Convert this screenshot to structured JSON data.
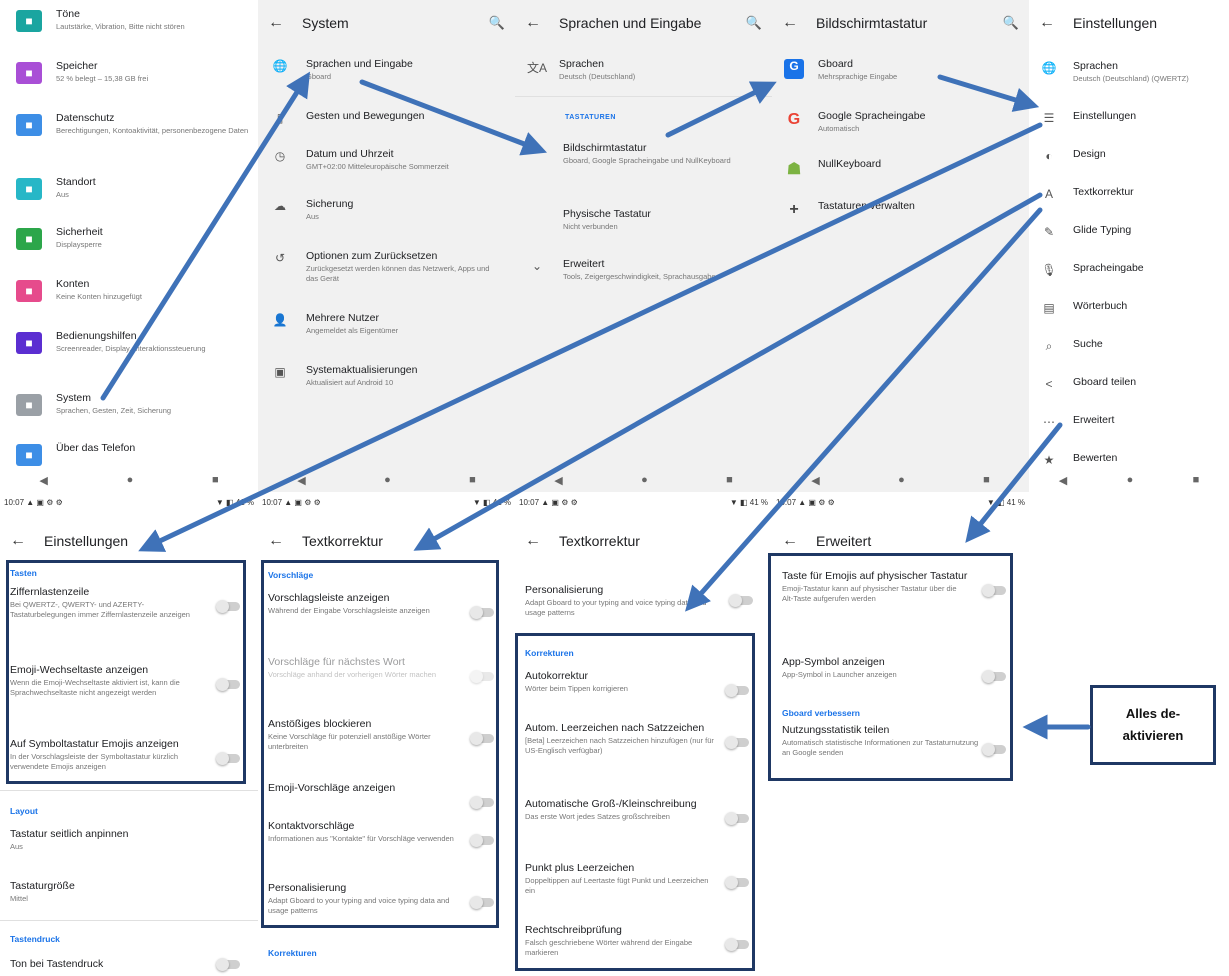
{
  "settings_list": {
    "items": [
      {
        "title": "Töne",
        "sub": "Lautstärke, Vibration, Bitte nicht stören",
        "color": "#1aa5a0",
        "icon": "volume-icon"
      },
      {
        "title": "Speicher",
        "sub": "52 % belegt – 15,38 GB frei",
        "color": "#a94fd6",
        "icon": "storage-icon"
      },
      {
        "title": "Datenschutz",
        "sub": "Berechtigungen, Kontoaktivität, personenbezogene Daten",
        "color": "#3d8ee6",
        "icon": "privacy-icon"
      },
      {
        "title": "Standort",
        "sub": "Aus",
        "color": "#27b7c7",
        "icon": "location-icon"
      },
      {
        "title": "Sicherheit",
        "sub": "Displaysperre",
        "color": "#2ca64a",
        "icon": "lock-icon"
      },
      {
        "title": "Konten",
        "sub": "Keine Konten hinzugefügt",
        "color": "#e64b8c",
        "icon": "account-icon"
      },
      {
        "title": "Bedienungshilfen",
        "sub": "Screenreader, Display, Interaktionssteuerung",
        "color": "#5b2ed1",
        "icon": "accessibility-icon"
      },
      {
        "title": "System",
        "sub": "Sprachen, Gesten, Zeit, Sicherung",
        "color": "#9aa0a6",
        "icon": "info-icon"
      },
      {
        "title": "Über das Telefon",
        "sub": "",
        "color": "#3d8ee6",
        "icon": "phone-icon"
      }
    ]
  },
  "system": {
    "title": "System",
    "items": [
      {
        "title": "Sprachen und Eingabe",
        "sub": "Gboard",
        "icon": "globe-icon",
        "glyph": "🌐"
      },
      {
        "title": "Gesten und Bewegungen",
        "sub": "",
        "icon": "gesture-icon",
        "glyph": "▯"
      },
      {
        "title": "Datum und Uhrzeit",
        "sub": "GMT+02:00 Mitteleuropäische Sommerzeit",
        "icon": "clock-icon",
        "glyph": "◷"
      },
      {
        "title": "Sicherung",
        "sub": "Aus",
        "icon": "backup-icon",
        "glyph": "☁"
      },
      {
        "title": "Optionen zum Zurücksetzen",
        "sub": "Zurückgesetzt werden können das Netzwerk, Apps und das Gerät",
        "icon": "reset-icon",
        "glyph": "↺"
      },
      {
        "title": "Mehrere Nutzer",
        "sub": "Angemeldet als Eigentümer",
        "icon": "user-icon",
        "glyph": "👤"
      },
      {
        "title": "Systemaktualisierungen",
        "sub": "Aktualisiert auf Android 10",
        "icon": "update-icon",
        "glyph": "▣"
      }
    ]
  },
  "sprachen": {
    "title": "Sprachen und Eingabe",
    "lang_title": "Sprachen",
    "lang_sub": "Deutsch (Deutschland)",
    "section": "TASTATUREN",
    "items": [
      {
        "title": "Bildschirmtastatur",
        "sub": "Gboard, Google Spracheingabe und NullKeyboard"
      },
      {
        "title": "Physische Tastatur",
        "sub": "Nicht verbunden"
      },
      {
        "title": "Erweitert",
        "sub": "Tools, Zeigergeschwindigkeit, Sprachausgabe"
      }
    ]
  },
  "bildschirm": {
    "title": "Bildschirmtastatur",
    "items": [
      {
        "title": "Gboard",
        "sub": "Mehrsprachige Eingabe",
        "icon": "gboard-icon"
      },
      {
        "title": "Google Spracheingabe",
        "sub": "Automatisch",
        "icon": "google-icon"
      },
      {
        "title": "NullKeyboard",
        "sub": "",
        "icon": "android-icon"
      },
      {
        "title": "Tastaturen verwalten",
        "sub": "",
        "icon": "plus-icon"
      }
    ]
  },
  "gboard": {
    "title": "Einstellungen",
    "items": [
      {
        "title": "Sprachen",
        "sub": "Deutsch (Deutschland) (QWERTZ)",
        "icon": "globe-icon",
        "glyph": "🌐"
      },
      {
        "title": "Einstellungen",
        "sub": "",
        "icon": "sliders-icon",
        "glyph": "☰"
      },
      {
        "title": "Design",
        "sub": "",
        "icon": "palette-icon",
        "glyph": "◐"
      },
      {
        "title": "Textkorrektur",
        "sub": "",
        "icon": "spellcheck-icon",
        "glyph": "A"
      },
      {
        "title": "Glide Typing",
        "sub": "",
        "icon": "glide-icon",
        "glyph": "✎"
      },
      {
        "title": "Spracheingabe",
        "sub": "",
        "icon": "mic-icon",
        "glyph": "🎙"
      },
      {
        "title": "Wörterbuch",
        "sub": "",
        "icon": "book-icon",
        "glyph": "▤"
      },
      {
        "title": "Suche",
        "sub": "",
        "icon": "search-icon",
        "glyph": "⌕"
      },
      {
        "title": "Gboard teilen",
        "sub": "",
        "icon": "share-icon",
        "glyph": "<"
      },
      {
        "title": "Erweitert",
        "sub": "",
        "icon": "more-icon",
        "glyph": "⋯"
      },
      {
        "title": "Bewerten",
        "sub": "",
        "icon": "star-icon",
        "glyph": "★"
      }
    ]
  },
  "statusbar": {
    "time": "10:07",
    "icons": "▲ ▣ ⚙ ⚙",
    "battery": "▼ ◧ 41 %"
  },
  "nav": {
    "back": "◀",
    "home": "●",
    "recent": "■"
  },
  "einst": {
    "title": "Einstellungen",
    "tasten": "Tasten",
    "rows": [
      {
        "title": "Ziffernlastenzeile",
        "sub": "Bei QWERTZ-, QWERTY- und AZERTY-Tastaturbelegungen immer Ziffernlastenzeile anzeigen"
      },
      {
        "title": "Emoji-Wechseltaste anzeigen",
        "sub": "Wenn die Emoji-Wechseltaste aktiviert ist, kann die Sprachwechseltaste nicht angezeigt werden"
      },
      {
        "title": "Auf Symboltastatur Emojis anzeigen",
        "sub": "In der Vorschlagsleiste der Symboltastatur kürzlich verwendete Emojis anzeigen"
      }
    ],
    "layout": "Layout",
    "layout_rows": [
      {
        "title": "Tastatur seitlich anpinnen",
        "sub": "Aus"
      },
      {
        "title": "Tastaturgröße",
        "sub": "Mittel"
      }
    ],
    "tastendruck": "Tastendruck",
    "ton": "Ton bei Tastendruck"
  },
  "text1": {
    "title": "Textkorrektur",
    "section": "Vorschläge",
    "rows": [
      {
        "title": "Vorschlagsleiste anzeigen",
        "sub": "Während der Eingabe Vorschlagsleiste anzeigen"
      },
      {
        "title": "Vorschläge für nächstes Wort",
        "sub": "Vorschläge anhand der vorherigen Wörter machen"
      },
      {
        "title": "Anstößiges blockieren",
        "sub": "Keine Vorschläge für potenziell anstößige Wörter unterbreiten"
      },
      {
        "title": "Emoji-Vorschläge anzeigen",
        "sub": ""
      },
      {
        "title": "Kontaktvorschläge",
        "sub": "Informationen aus \"Kontakte\" für Vorschläge verwenden"
      },
      {
        "title": "Personalisierung",
        "sub": "Adapt Gboard to your typing and voice typing data and usage patterns"
      }
    ],
    "korrekturen": "Korrekturen"
  },
  "text2": {
    "title": "Textkorrektur",
    "top_title": "Personalisierung",
    "top_sub": "Adapt Gboard to your typing and voice typing data and usage patterns",
    "section": "Korrekturen",
    "rows": [
      {
        "title": "Autokorrektur",
        "sub": "Wörter beim Tippen korrigieren"
      },
      {
        "title": "Autom. Leerzeichen nach Satzzeichen",
        "sub": "[Beta] Leerzeichen nach Satzzeichen hinzufügen (nur für US-Englisch verfügbar)"
      },
      {
        "title": "Automatische Groß-/Kleinschreibung",
        "sub": "Das erste Wort jedes Satzes großschreiben"
      },
      {
        "title": "Punkt plus Leerzeichen",
        "sub": "Doppeltippen auf Leertaste fügt Punkt und Leerzeichen ein"
      },
      {
        "title": "Rechtschreibprüfung",
        "sub": "Falsch geschriebene Wörter während der Eingabe markieren"
      }
    ]
  },
  "erw": {
    "title": "Erweitert",
    "rows": [
      {
        "title": "Taste für Emojis auf physischer Tastatur",
        "sub": "Emoji-Tastatur kann auf physischer Tastatur über die Alt-Taste aufgerufen werden"
      },
      {
        "title": "App-Symbol anzeigen",
        "sub": "App-Symbol in Launcher anzeigen"
      }
    ],
    "section": "Gboard verbessern",
    "stat_title": "Nutzungsstatistik teilen",
    "stat_sub": "Automatisch statistische Informationen zur Tastaturnutzung an Google senden"
  },
  "callout": "Alles de-\naktivieren",
  "colors": {
    "arrow": "#3f72b8",
    "box": "#1f3864",
    "accent": "#1a73e8"
  }
}
